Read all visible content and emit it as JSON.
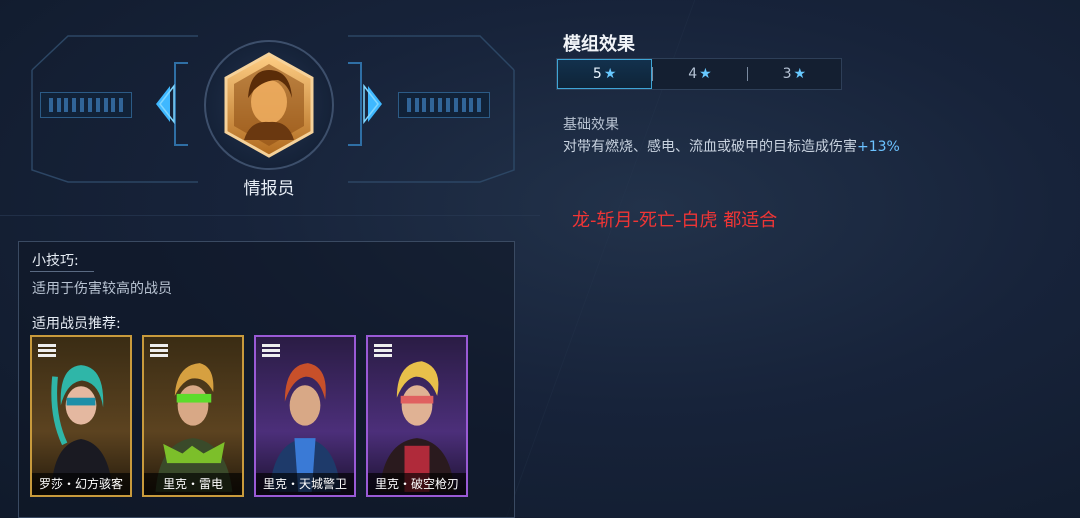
{
  "role": {
    "name": "情报员"
  },
  "module": {
    "title": "模组效果",
    "tabs": [
      {
        "label": "5",
        "star": "★",
        "active": true
      },
      {
        "label": "4",
        "star": "★",
        "active": false
      },
      {
        "label": "3",
        "star": "★",
        "active": false
      }
    ],
    "basic_title": "基础效果",
    "basic_text": "对带有燃烧、感电、流血或破甲的目标造成伤害",
    "basic_bonus": "+13%"
  },
  "note": "龙-斩月-死亡-白虎 都适合",
  "tips": {
    "title": "小技巧:",
    "text": "适用于伤害较高的战员",
    "rec_title": "适用战员推荐:",
    "cards": [
      {
        "name": "罗莎・幻方骇客",
        "rarity": "gold"
      },
      {
        "name": "里克・雷电",
        "rarity": "gold"
      },
      {
        "name": "里克・天城警卫",
        "rarity": "purple"
      },
      {
        "name": "里克・破空枪刃",
        "rarity": "purple"
      }
    ]
  },
  "colors": {
    "accent": "#3fa5d6",
    "highlight": "#6cc2ff",
    "note": "#f03535",
    "gold": "#c89a3c",
    "purple": "#9a5ad6"
  }
}
